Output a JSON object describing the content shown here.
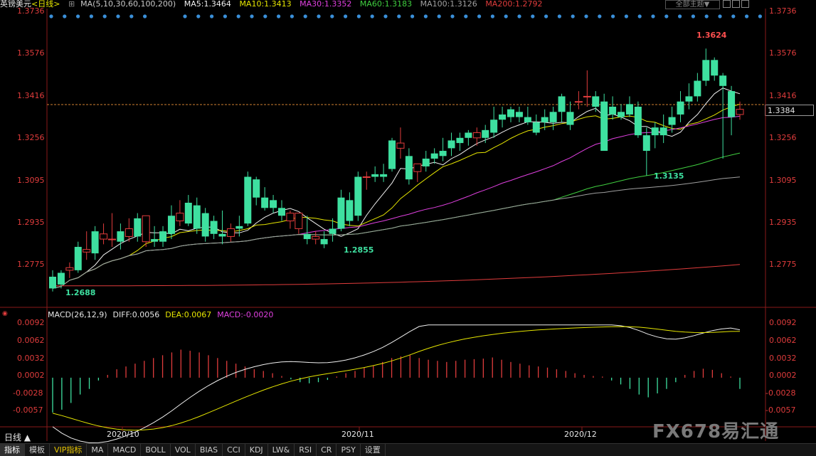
{
  "header": {
    "title": "英镑美元",
    "period": "<日线>",
    "ma_label": "MA(5,10,30,60,100,200)",
    "ma_values": [
      {
        "label": "MA5:1.3464",
        "color": "#f0f0f0"
      },
      {
        "label": "MA10:1.3413",
        "color": "#e6e600"
      },
      {
        "label": "MA30:1.3352",
        "color": "#e040e0"
      },
      {
        "label": "MA60:1.3183",
        "color": "#40d040"
      },
      {
        "label": "MA100:1.3126",
        "color": "#a0a0a0"
      },
      {
        "label": "MA200:1.2792",
        "color": "#e03c3c"
      }
    ],
    "theme_button": "全部主题▼"
  },
  "price_axis": {
    "ticks": [
      "1.3736",
      "1.3576",
      "1.3416",
      "1.3256",
      "1.3095",
      "1.2935",
      "1.2775"
    ],
    "left_ticks": [
      "1.3736",
      "1.3576",
      "1.3416",
      "1.3256",
      "1.3095",
      "1.2935",
      "1.2775"
    ],
    "current_price": "1.3384"
  },
  "annotations": {
    "high": "1.3624",
    "low_left": "1.2688",
    "low_mid": "1.2855",
    "low_right": "1.3135"
  },
  "macd": {
    "legend": [
      {
        "label": "MACD(26,12,9)",
        "color": "#e6e6e6"
      },
      {
        "label": "DIFF:0.0056",
        "color": "#e6e6e6"
      },
      {
        "label": "DEA:0.0067",
        "color": "#e6e600"
      },
      {
        "label": "MACD:-0.0020",
        "color": "#e040e0"
      }
    ],
    "ticks": [
      "0.0092",
      "0.0062",
      "0.0032",
      "0.0002",
      "-0.0028",
      "-0.0057"
    ]
  },
  "dates": [
    "2020/10",
    "2020/11",
    "2020/12"
  ],
  "period_label": "日线 ▲",
  "tabs": [
    "指标",
    "模板",
    "VIP指标",
    "MA",
    "MACD",
    "BOLL",
    "VOL",
    "BIAS",
    "CCI",
    "KDJ",
    "LW&",
    "RSI",
    "CR",
    "PSY",
    "设置"
  ],
  "watermark": "FX678易汇通",
  "colors": {
    "up": "#e03c3c",
    "down": "#3ee0a0",
    "background": "#000000"
  },
  "chart_data": {
    "type": "candlestick",
    "candles": [
      [
        1.2745,
        1.277,
        1.27,
        1.2688
      ],
      [
        1.276,
        1.277,
        1.2715,
        1.27
      ],
      [
        1.277,
        1.28,
        1.278,
        1.274
      ],
      [
        1.286,
        1.288,
        1.277,
        1.276
      ],
      [
        1.284,
        1.292,
        1.285,
        1.281
      ],
      [
        1.292,
        1.294,
        1.2835,
        1.281
      ],
      [
        1.289,
        1.295,
        1.291,
        1.287
      ],
      [
        1.289,
        1.299,
        1.289,
        1.286
      ],
      [
        1.292,
        1.295,
        1.288,
        1.285
      ],
      [
        1.29,
        1.297,
        1.293,
        1.288
      ],
      [
        1.297,
        1.299,
        1.29,
        1.288
      ],
      [
        1.288,
        1.296,
        1.298,
        1.286
      ],
      [
        1.289,
        1.294,
        1.288,
        1.286
      ],
      [
        1.292,
        1.294,
        1.288,
        1.286
      ],
      [
        1.298,
        1.302,
        1.291,
        1.289
      ],
      [
        1.296,
        1.304,
        1.299,
        1.294
      ],
      [
        1.303,
        1.306,
        1.295,
        1.294
      ],
      [
        1.302,
        1.305,
        1.293,
        1.291
      ],
      [
        1.299,
        1.301,
        1.29,
        1.288
      ],
      [
        1.296,
        1.298,
        1.291,
        1.289
      ],
      [
        1.291,
        1.3,
        1.29,
        1.287
      ],
      [
        1.29,
        1.295,
        1.293,
        1.288
      ],
      [
        1.294,
        1.298,
        1.293,
        1.29
      ],
      [
        1.313,
        1.315,
        1.295,
        1.294
      ],
      [
        1.312,
        1.313,
        1.305,
        1.302
      ],
      [
        1.305,
        1.309,
        1.301,
        1.3
      ],
      [
        1.304,
        1.306,
        1.301,
        1.299
      ],
      [
        1.301,
        1.304,
        1.298,
        1.296
      ],
      [
        1.296,
        1.3,
        1.299,
        1.293
      ],
      [
        1.293,
        1.296,
        1.299,
        1.291
      ],
      [
        1.291,
        1.298,
        1.289,
        1.287
      ],
      [
        1.289,
        1.292,
        1.29,
        1.287
      ],
      [
        1.289,
        1.292,
        1.287,
        1.2855
      ],
      [
        1.293,
        1.297,
        1.291,
        1.288
      ],
      [
        1.305,
        1.308,
        1.293,
        1.292
      ],
      [
        1.304,
        1.307,
        1.296,
        1.294
      ],
      [
        1.313,
        1.315,
        1.298,
        1.296
      ],
      [
        1.313,
        1.315,
        1.313,
        1.308
      ],
      [
        1.314,
        1.317,
        1.313,
        1.311
      ],
      [
        1.314,
        1.318,
        1.313,
        1.311
      ],
      [
        1.327,
        1.328,
        1.316,
        1.315
      ],
      [
        1.324,
        1.332,
        1.326,
        1.32
      ],
      [
        1.321,
        1.324,
        1.312,
        1.31
      ],
      [
        1.315,
        1.318,
        1.318,
        1.311
      ],
      [
        1.32,
        1.323,
        1.317,
        1.315
      ],
      [
        1.322,
        1.324,
        1.32,
        1.318
      ],
      [
        1.323,
        1.328,
        1.321,
        1.319
      ],
      [
        1.327,
        1.33,
        1.324,
        1.321
      ],
      [
        1.328,
        1.33,
        1.326,
        1.323
      ],
      [
        1.33,
        1.331,
        1.328,
        1.325
      ],
      [
        1.328,
        1.332,
        1.33,
        1.325
      ],
      [
        1.331,
        1.333,
        1.328,
        1.326
      ],
      [
        1.335,
        1.34,
        1.33,
        1.328
      ],
      [
        1.337,
        1.34,
        1.335,
        1.332
      ],
      [
        1.339,
        1.34,
        1.336,
        1.334
      ],
      [
        1.338,
        1.34,
        1.336,
        1.334
      ],
      [
        1.336,
        1.34,
        1.334,
        1.333
      ],
      [
        1.334,
        1.337,
        1.33,
        1.329
      ],
      [
        1.336,
        1.339,
        1.334,
        1.331
      ],
      [
        1.338,
        1.34,
        1.334,
        1.331
      ],
      [
        1.344,
        1.345,
        1.338,
        1.334
      ],
      [
        1.338,
        1.342,
        1.333,
        1.331
      ],
      [
        1.342,
        1.346,
        1.342,
        1.339
      ],
      [
        1.344,
        1.354,
        1.344,
        1.34
      ],
      [
        1.344,
        1.346,
        1.34,
        1.338
      ],
      [
        1.342,
        1.345,
        1.323,
        1.323
      ],
      [
        1.34,
        1.344,
        1.337,
        1.335
      ],
      [
        1.338,
        1.341,
        1.336,
        1.335
      ],
      [
        1.341,
        1.344,
        1.337,
        1.336
      ],
      [
        1.34,
        1.342,
        1.329,
        1.328
      ],
      [
        1.329,
        1.332,
        1.323,
        1.3135
      ],
      [
        1.332,
        1.334,
        1.329,
        1.324
      ],
      [
        1.332,
        1.337,
        1.329,
        1.326
      ],
      [
        1.336,
        1.34,
        1.333,
        1.33
      ],
      [
        1.342,
        1.346,
        1.337,
        1.334
      ],
      [
        1.344,
        1.349,
        1.342,
        1.339
      ],
      [
        1.35,
        1.353,
        1.344,
        1.342
      ],
      [
        1.358,
        1.3624,
        1.35,
        1.348
      ],
      [
        1.358,
        1.359,
        1.352,
        1.35
      ],
      [
        1.352,
        1.353,
        1.348,
        1.32
      ],
      [
        1.346,
        1.348,
        1.336,
        1.329
      ],
      [
        1.337,
        1.342,
        1.339,
        1.335
      ]
    ],
    "y_range": [
      1.266,
      1.377
    ],
    "price_ticks": [
      1.3736,
      1.3576,
      1.3416,
      1.3256,
      1.3095,
      1.2935,
      1.2775
    ],
    "macd_hist": [
      -0.0062,
      -0.0057,
      -0.0045,
      -0.003,
      -0.002,
      -0.0005,
      0.0005,
      0.0015,
      0.002,
      0.0025,
      0.003,
      0.0035,
      0.004,
      0.0045,
      0.005,
      0.0048,
      0.0045,
      0.004,
      0.0035,
      0.003,
      0.0025,
      0.002,
      0.0015,
      0.0012,
      0.0008,
      0.0003,
      -0.0003,
      -0.0008,
      -0.001,
      -0.0008,
      -0.0004,
      0.0002,
      0.0008,
      0.0012,
      0.0018,
      0.0022,
      0.0028,
      0.0035,
      0.0038,
      0.004,
      0.0035,
      0.0032,
      0.003,
      0.0028,
      0.003,
      0.0032,
      0.0033,
      0.0034,
      0.0036,
      0.0032,
      0.0028,
      0.0025,
      0.0022,
      0.002,
      0.0018,
      0.0015,
      0.0012,
      0.0008,
      0.0005,
      0.0003,
      0.0002,
      -0.0005,
      -0.0012,
      -0.002,
      -0.003,
      -0.0035,
      -0.0028,
      -0.002,
      -0.0008,
      0.0005,
      0.0012,
      0.0016,
      0.0014,
      0.0008,
      0.0002,
      -0.002
    ],
    "macd_range": [
      -0.0085,
      0.01
    ],
    "macd_ticks": [
      0.0092,
      0.0062,
      0.0032,
      0.0002,
      -0.0028,
      -0.0057
    ]
  }
}
